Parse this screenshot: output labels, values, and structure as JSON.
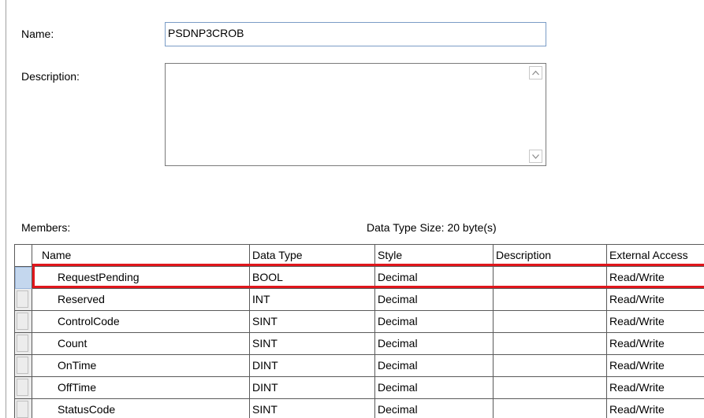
{
  "form": {
    "name_label": "Name:",
    "name_value": "PSDNP3CROB",
    "description_label": "Description:",
    "description_value": "",
    "members_label": "Members:",
    "data_type_size": "Data Type Size: 20 byte(s)"
  },
  "table": {
    "columns": [
      "Name",
      "Data Type",
      "Style",
      "Description",
      "External Access"
    ],
    "rows": [
      {
        "name": "RequestPending",
        "data_type": "BOOL",
        "style": "Decimal",
        "description": "",
        "external_access": "Read/Write",
        "selected": true
      },
      {
        "name": "Reserved",
        "data_type": "INT",
        "style": "Decimal",
        "description": "",
        "external_access": "Read/Write"
      },
      {
        "name": "ControlCode",
        "data_type": "SINT",
        "style": "Decimal",
        "description": "",
        "external_access": "Read/Write"
      },
      {
        "name": "Count",
        "data_type": "SINT",
        "style": "Decimal",
        "description": "",
        "external_access": "Read/Write"
      },
      {
        "name": "OnTime",
        "data_type": "DINT",
        "style": "Decimal",
        "description": "",
        "external_access": "Read/Write"
      },
      {
        "name": "OffTime",
        "data_type": "DINT",
        "style": "Decimal",
        "description": "",
        "external_access": "Read/Write"
      },
      {
        "name": "StatusCode",
        "data_type": "SINT",
        "style": "Decimal",
        "description": "",
        "external_access": "Read/Write"
      }
    ]
  },
  "colors": {
    "highlight": "#e0161c",
    "selected_row_header": "#c4d7ee"
  },
  "icons": {
    "scroll_up": "chevron-up-icon",
    "scroll_down": "chevron-down-icon"
  }
}
